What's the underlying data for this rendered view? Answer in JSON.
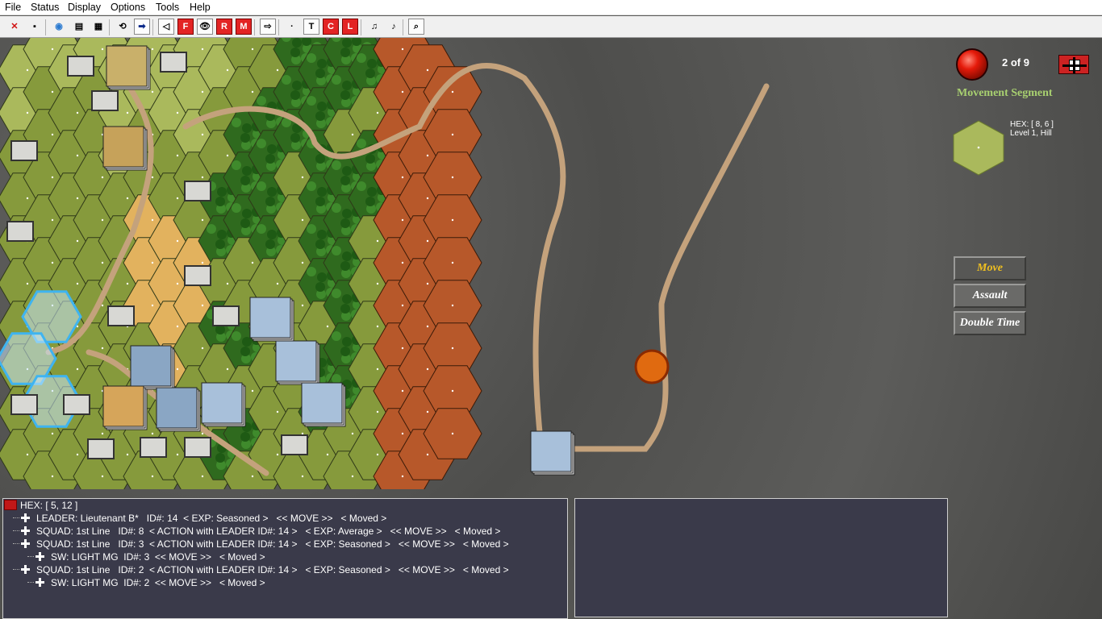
{
  "menu": [
    "File",
    "Status",
    "Display",
    "Options",
    "Tools",
    "Help"
  ],
  "toolbar": {
    "buttons": [
      {
        "name": "close-icon",
        "label": "✕",
        "style": "plain"
      },
      {
        "name": "save-icon",
        "label": "▪",
        "style": "plain"
      },
      {
        "name": "globe-icon",
        "label": "◉",
        "style": "plain"
      },
      {
        "name": "panel-icon",
        "label": "▤",
        "style": "plain"
      },
      {
        "name": "film-icon",
        "label": "▦",
        "style": "plain"
      },
      {
        "name": "replay-icon",
        "label": "⟲",
        "style": "plain"
      },
      {
        "name": "next-arrow-icon",
        "label": "➡",
        "style": "box"
      },
      {
        "name": "back-arrow-icon",
        "label": "◁",
        "style": "box"
      },
      {
        "name": "f-toggle",
        "label": "F",
        "style": "red"
      },
      {
        "name": "eye-icon",
        "label": "👁",
        "style": "box"
      },
      {
        "name": "r-toggle",
        "label": "R",
        "style": "red"
      },
      {
        "name": "m-toggle",
        "label": "M",
        "style": "red"
      },
      {
        "name": "arrow-right-icon",
        "label": "⇨",
        "style": "box"
      },
      {
        "name": "dot-icon",
        "label": "·",
        "style": "plain"
      },
      {
        "name": "t-toggle",
        "label": "T",
        "style": "box"
      },
      {
        "name": "c-toggle",
        "label": "C",
        "style": "red"
      },
      {
        "name": "l-toggle",
        "label": "L",
        "style": "red"
      },
      {
        "name": "fx-music-icon",
        "label": "♫",
        "style": "plain"
      },
      {
        "name": "music-icon",
        "label": "♪",
        "style": "plain"
      },
      {
        "name": "zoom-icon",
        "label": "⌕",
        "style": "box"
      }
    ]
  },
  "status": {
    "turn": "2 of 9",
    "phase": "Movement Segment",
    "hex": "HEX: [ 8, 6 ]",
    "terrain": "Level 1, Hill"
  },
  "actions": [
    "Move",
    "Assault",
    "Double Time"
  ],
  "unit_list": {
    "header": "HEX: [ 5, 12 ]",
    "rows": [
      {
        "indent": 0,
        "text": "LEADER: Lieutenant B*   ID#: 14  < EXP: Seasoned >   << MOVE >>   < Moved >"
      },
      {
        "indent": 0,
        "text": "SQUAD: 1st Line   ID#: 8  < ACTION with LEADER ID#: 14 >   < EXP: Average >   << MOVE >>   < Moved >"
      },
      {
        "indent": 0,
        "text": "SQUAD: 1st Line   ID#: 3  < ACTION with LEADER ID#: 14 >   < EXP: Seasoned >   << MOVE >>   < Moved >"
      },
      {
        "indent": 1,
        "text": "SW: LIGHT MG  ID#: 3  << MOVE >>   < Moved >"
      },
      {
        "indent": 0,
        "text": "SQUAD: 1st Line   ID#: 2  < ACTION with LEADER ID#: 14 >   < EXP: Seasoned >   << MOVE >>   < Moved >"
      },
      {
        "indent": 1,
        "text": "SW: LIGHT MG  ID#: 2  << MOVE >>   < Moved >"
      }
    ]
  },
  "colors": {
    "grass": "#869a3c",
    "forest": "#2f6a1e",
    "wheat": "#e2b25e",
    "hill": "#aab95c",
    "cliff": "#b7582a",
    "road": "#c4a27c",
    "selected": "#3fb4f0"
  }
}
